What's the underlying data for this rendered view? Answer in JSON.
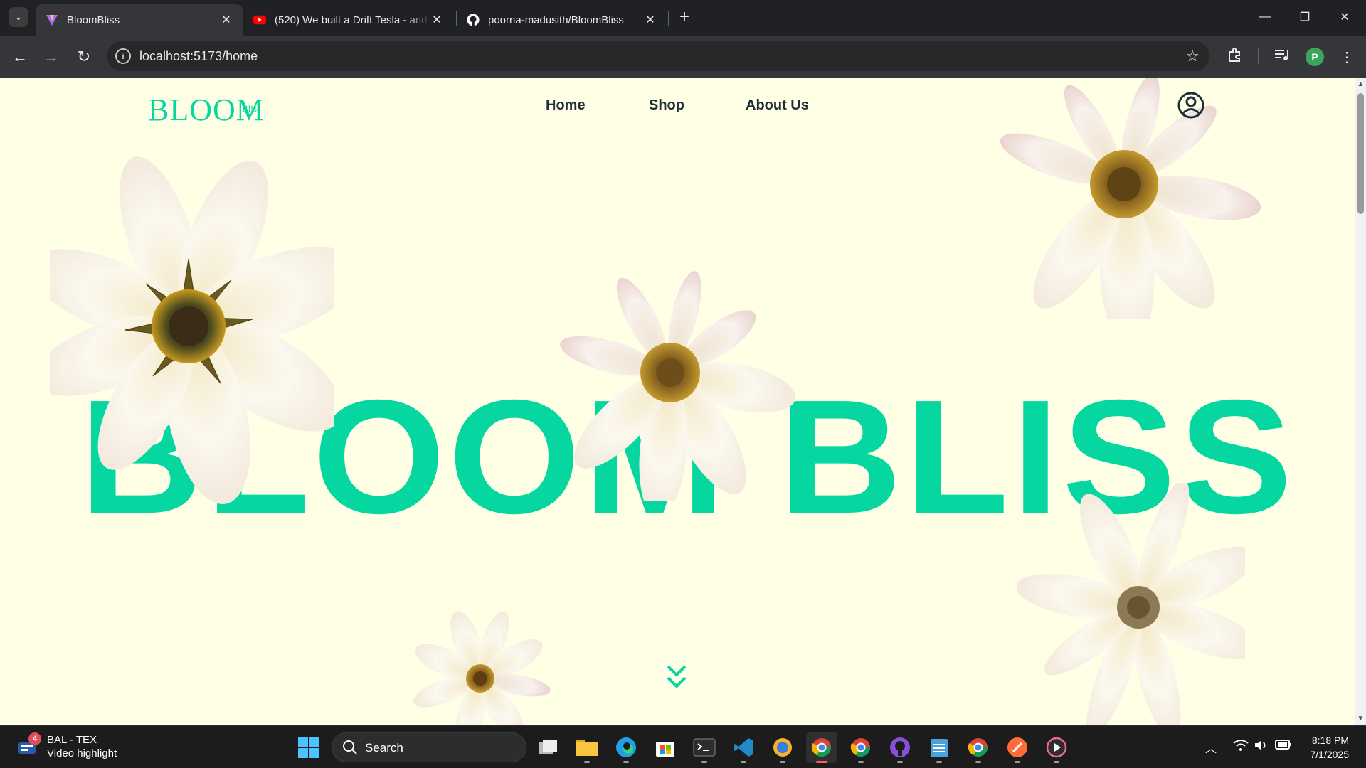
{
  "browser": {
    "tabs": [
      {
        "title": "BloomBliss",
        "icon": "vite-icon",
        "active": true
      },
      {
        "title": "(520) We built a Drift Tesla - and",
        "icon": "youtube-icon",
        "active": false
      },
      {
        "title": "poorna-madusith/BloomBliss",
        "icon": "github-icon",
        "active": false
      }
    ],
    "url": "localhost:5173/home",
    "profile_initial": "P"
  },
  "site": {
    "logo": "BLOOM",
    "logo_sub": "Bliss",
    "nav": [
      "Home",
      "Shop",
      "About Us"
    ],
    "hero_title": "BLOOM BLISS",
    "accent_color": "#06d6a0",
    "background_color": "#ffffe5"
  },
  "taskbar": {
    "widget_title": "BAL - TEX",
    "widget_subtitle": "Video highlight",
    "widget_badge": "4",
    "search_label": "Search",
    "time": "8:18 PM",
    "date": "7/1/2025"
  }
}
